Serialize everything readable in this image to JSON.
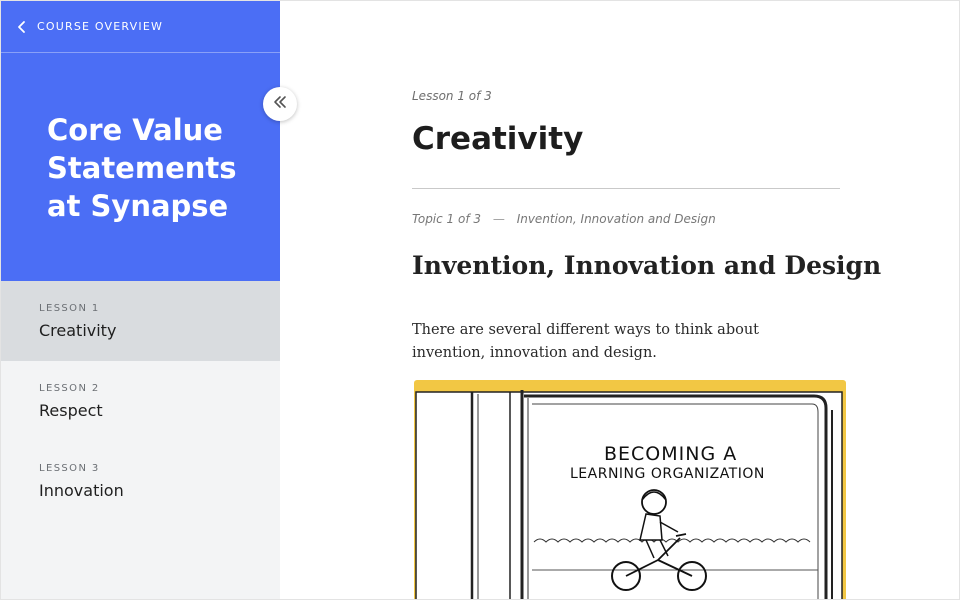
{
  "sidebar": {
    "back_label": "COURSE OVERVIEW",
    "course_title": "Core Value Statements at Synapse",
    "header_color": "#4b6ef5",
    "lessons": [
      {
        "kicker": "LESSON 1",
        "name": "Creativity",
        "active": true
      },
      {
        "kicker": "LESSON 2",
        "name": "Respect",
        "active": false
      },
      {
        "kicker": "LESSON 3",
        "name": "Innovation",
        "active": false
      }
    ],
    "collapse_icon": "double-chevron-left-icon"
  },
  "main": {
    "lesson_counter": "Lesson 1 of 3",
    "lesson_title": "Creativity",
    "topic_counter": "Topic 1 of 3",
    "topic_separator": "—",
    "topic_name": "Invention, Innovation and Design",
    "topic_title": "Invention, Innovation and Design",
    "body_text": "There are several different ways to think about invention, innovation and design.",
    "illustration": {
      "line1": "BECOMING A",
      "line2": "LEARNING ORGANIZATION",
      "background_color": "#f2c744"
    }
  }
}
